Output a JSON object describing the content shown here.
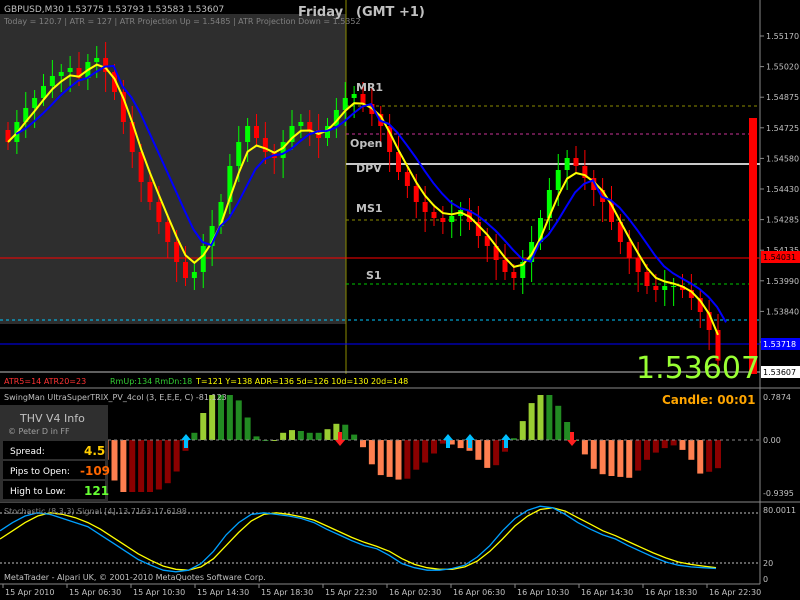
{
  "main": {
    "header_line1": "GBPUSD,M30  1.53775 1.53793 1.53583 1.53607",
    "header_line2": "Today = 120.7  |  ATR = 127  |  ATR Projection Up = 1.5485  |  ATR Projection Down = 1.5352",
    "day_label": "Friday",
    "tz_label": "(GMT +1)",
    "big_price": "1.53607",
    "level_labels": [
      "MR1",
      "Open",
      "DPV",
      "MS1",
      "S1"
    ],
    "price_ticks": [
      "1.55170",
      "1.55020",
      "1.54875",
      "1.54725",
      "1.54580",
      "1.54430",
      "1.54285",
      "1.54135",
      "1.53990",
      "1.53840",
      "1.53695",
      "1.53607"
    ],
    "price_markers": [
      {
        "text": "1.54031",
        "color": "#ff0000"
      },
      {
        "text": "1.53718",
        "color": "#0000ff"
      }
    ],
    "status": {
      "atr": "ATR5=14  ATR20=23",
      "rm": "RmUp:134  RmDn:18",
      "stats": "T=121  Y=138  ADR=136  5d=126  10d=130  20d=148"
    }
  },
  "indicator1": {
    "title": "SwingMan UltraSuperTRIX_PV_4col (3, E,E,E, C) -81.123",
    "candle_text": "Candle:  00:01",
    "ticks": [
      "0.7874",
      "0.00",
      "-0.9395"
    ]
  },
  "info_panel": {
    "title": "THV  V4 Info",
    "subtitle": "© Peter D in FF",
    "rows": [
      {
        "label": "Spread:",
        "value": "4.5",
        "color": "#ffcc00"
      },
      {
        "label": "Pips to Open:",
        "value": "-109",
        "color": "#ff6600"
      },
      {
        "label": "High to Low:",
        "value": "121",
        "color": "#66ff33"
      }
    ]
  },
  "indicator2": {
    "title": "Stochastic (8,3,3) Signal  [4].13.7163  17.6198",
    "ticks": [
      "80.0011",
      "20",
      "0"
    ],
    "footer": "MetaTrader - Alpari UK, © 2001-2010 MetaQuotes Software Corp."
  },
  "time_axis": [
    "15 Apr 2010",
    "15 Apr 06:30",
    "15 Apr 10:30",
    "15 Apr 14:30",
    "15 Apr 18:30",
    "15 Apr 22:30",
    "16 Apr 02:30",
    "16 Apr 06:30",
    "16 Apr 10:30",
    "16 Apr 14:30",
    "16 Apr 18:30",
    "16 Apr 22:30"
  ],
  "colors": {
    "bull": "#00ff00",
    "bear": "#ff0000",
    "ma_yellow": "#ffff00",
    "ma_blue": "#0000ff",
    "stoch_main": "#00a0ff",
    "stoch_signal": "#ffff00",
    "panel_bg": "#2f2f2f"
  },
  "chart_data": {
    "type": "candlestick",
    "symbol": "GBPUSD",
    "timeframe": "M30",
    "ylim": [
      1.5355,
      1.5523
    ],
    "last_price": 1.53607,
    "open_ohlc": [
      1.53775,
      1.53793,
      1.53583,
      1.53607
    ],
    "closes": [
      1.547,
      1.548,
      1.5487,
      1.5492,
      1.5498,
      1.5503,
      1.5505,
      1.5507,
      1.5502,
      1.551,
      1.5512,
      1.5505,
      1.5495,
      1.548,
      1.5465,
      1.545,
      1.544,
      1.543,
      1.542,
      1.541,
      1.5402,
      1.5405,
      1.5418,
      1.5428,
      1.544,
      1.5458,
      1.547,
      1.5478,
      1.5472,
      1.5465,
      1.5462,
      1.547,
      1.5478,
      1.548,
      1.5476,
      1.5472,
      1.5478,
      1.5486,
      1.5492,
      1.5494,
      1.5489,
      1.5484,
      1.5478,
      1.5465,
      1.5455,
      1.5448,
      1.544,
      1.5435,
      1.5432,
      1.543,
      1.5433,
      1.5436,
      1.543,
      1.5423,
      1.5418,
      1.5411,
      1.5405,
      1.5402,
      1.541,
      1.542,
      1.5432,
      1.5446,
      1.5456,
      1.5462,
      1.5458,
      1.5452,
      1.5446,
      1.544,
      1.543,
      1.542,
      1.5412,
      1.5405,
      1.5398,
      1.5396,
      1.5398,
      1.5398,
      1.5396,
      1.5392,
      1.5385,
      1.5376,
      1.53607
    ],
    "levels": [
      {
        "name": "MR1",
        "value": 1.5488,
        "color": "#8c8c00"
      },
      {
        "name": "Open",
        "value": 1.5474,
        "color": "#c83296"
      },
      {
        "name": "DPV",
        "value": 1.5459,
        "color": "#c8c8c8"
      },
      {
        "name": "MS1",
        "value": 1.5431,
        "color": "#8c8c00"
      },
      {
        "name": "S1",
        "value": 1.5399,
        "color": "#00c800"
      }
    ],
    "stochastic": {
      "main": [
        60,
        70,
        78,
        82,
        80,
        75,
        70,
        65,
        55,
        45,
        35,
        25,
        18,
        12,
        10,
        12,
        20,
        35,
        55,
        70,
        80,
        82,
        80,
        78,
        75,
        70,
        62,
        55,
        48,
        42,
        38,
        30,
        20,
        15,
        12,
        12,
        14,
        18,
        28,
        42,
        60,
        75,
        85,
        90,
        88,
        80,
        70,
        62,
        55,
        50,
        42,
        35,
        28,
        22,
        18,
        16,
        15,
        14
      ],
      "signal": [
        50,
        60,
        70,
        78,
        82,
        80,
        76,
        70,
        62,
        52,
        42,
        32,
        24,
        17,
        13,
        12,
        16,
        26,
        42,
        58,
        72,
        80,
        82,
        80,
        77,
        73,
        66,
        59,
        52,
        46,
        41,
        35,
        26,
        19,
        15,
        13,
        13,
        16,
        23,
        35,
        50,
        66,
        78,
        86,
        88,
        84,
        76,
        68,
        60,
        54,
        47,
        40,
        33,
        27,
        22,
        19,
        17,
        15
      ]
    }
  }
}
